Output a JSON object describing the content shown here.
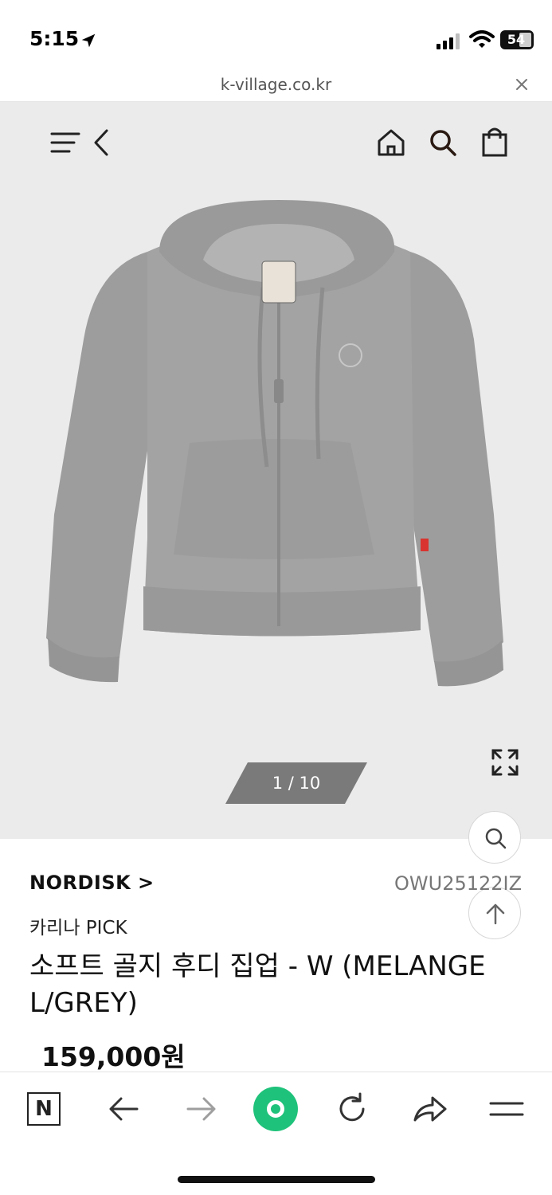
{
  "status_bar": {
    "time": "5:15",
    "battery": "54",
    "icons": [
      "location-arrow-icon",
      "signal-bars-icon",
      "wifi-icon",
      "battery-icon"
    ]
  },
  "browser": {
    "url": "k-village.co.kr",
    "close_icon": "close-icon"
  },
  "site_nav": {
    "icons": [
      "menu-icon",
      "back-chevron-icon",
      "home-icon",
      "search-icon",
      "shopping-bag-icon"
    ]
  },
  "gallery": {
    "counter": "1 / 10",
    "expand_icon": "expand-icon",
    "image_subject": "grey zip-up hoodie"
  },
  "floating": {
    "search_icon": "search-icon",
    "scroll_top_icon": "arrow-up-icon"
  },
  "product": {
    "brand": "NORDISK >",
    "code": "OWU25122IZ",
    "pick_tag": "카리나 PICK",
    "name": "소프트 골지 후디 집업 - W (MELANGE L/GREY)",
    "price": "159,000원"
  },
  "toolbar": {
    "n_label": "N",
    "icons": [
      "naver-n-icon",
      "arrow-left-icon",
      "arrow-right-icon",
      "green-home-icon",
      "reload-icon",
      "share-icon",
      "hamburger-icon"
    ]
  },
  "colors": {
    "hero_bg": "#ebebeb",
    "accent_green": "#1fc27a",
    "counter_bg": "#7a7a7a"
  }
}
